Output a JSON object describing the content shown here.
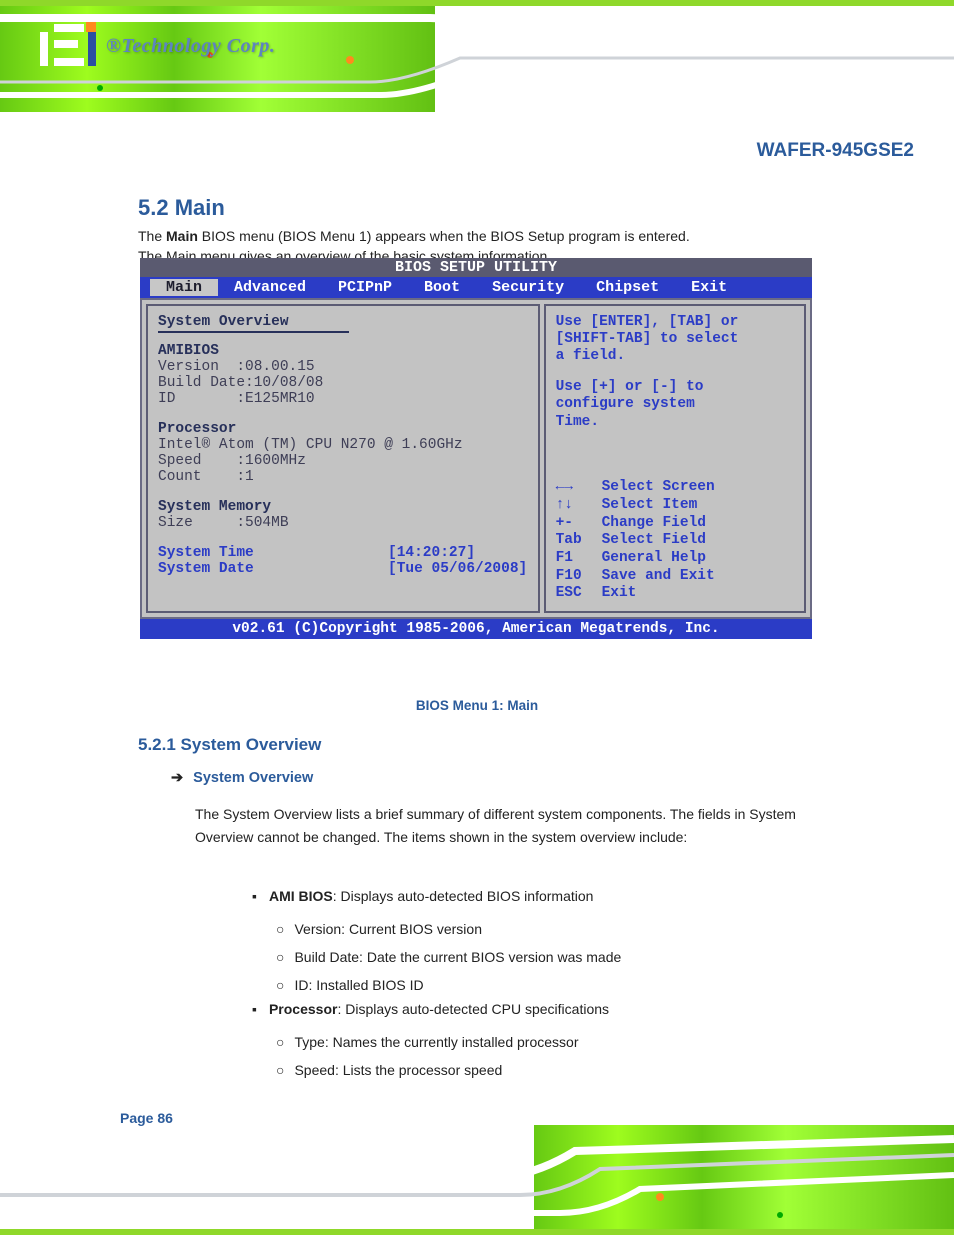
{
  "header": {
    "brand_tagline": "®Technology Corp."
  },
  "doc": {
    "title": "WAFER-945GSE2",
    "heading": "5.2 Main",
    "intro_1": "The ",
    "intro_bold": "Main",
    "intro_2": " BIOS menu (BIOS Menu 1) appears when the BIOS Setup program is entered.",
    "intro_3": "The Main menu gives an overview of the basic system information."
  },
  "bios": {
    "title": "BIOS SETUP UTILITY",
    "tabs": [
      "Main",
      "Advanced",
      "PCIPnP",
      "Boot",
      "Security",
      "Chipset",
      "Exit"
    ],
    "active_tab": 0,
    "left": {
      "overview": "System Overview",
      "amibios": "AMIBIOS",
      "version_label": "Version  :",
      "version": "08.00.15",
      "build_label": "Build Date:",
      "build": "10/08/08",
      "id_label": "ID       :",
      "id": "E125MR10",
      "processor": "Processor",
      "cpu": "Intel® Atom (TM) CPU N270 @ 1.60GHz",
      "speed_label": "Speed    :",
      "speed": "1600MHz",
      "count_label": "Count    :",
      "count": "1",
      "memory": "System Memory",
      "size_label": "Size     :",
      "size": "504MB",
      "time_label": "System Time",
      "time_value": "[14:20:27]",
      "date_label": "System Date",
      "date_value": "[Tue 05/06/2008]"
    },
    "right": {
      "help1": "Use [ENTER], [TAB] or",
      "help2": "[SHIFT-TAB] to select",
      "help3": "a field.",
      "help4": "Use [+] or [-] to",
      "help5": "configure system",
      "help6": "Time.",
      "nav": [
        {
          "key": "←→",
          "desc": "Select Screen"
        },
        {
          "key": "↑↓",
          "desc": "Select Item"
        },
        {
          "key": "+-",
          "desc": "Change Field"
        },
        {
          "key": "Tab",
          "desc": "Select Field"
        },
        {
          "key": "F1",
          "desc": "General Help"
        },
        {
          "key": "F10",
          "desc": "Save and Exit"
        },
        {
          "key": "ESC",
          "desc": "Exit"
        }
      ]
    },
    "footer": "v02.61 (C)Copyright 1985-2006, American Megatrends, Inc."
  },
  "caption": "BIOS Menu 1: Main",
  "subheading": "5.2.1 System Overview",
  "sysoverview_arrow": "System Overview",
  "sysoverview_para": "The System Overview lists a brief summary of different system components. The fields in System Overview cannot be changed. The items shown in the system overview include:",
  "bullet1_bold": "AMI BIOS",
  "bullet1_rest": ": Displays auto-detected BIOS information",
  "b1_sub_version": "Version: Current BIOS version",
  "b1_sub_build": "Build Date: Date the current BIOS version was made",
  "b1_sub_id": "ID: Installed BIOS ID",
  "bullet2_bold": "Processor",
  "bullet2_rest": ": Displays auto-detected CPU specifications",
  "b2_sub_type": "Type: Names the currently installed processor",
  "b2_sub_speed": "Speed: Lists the processor speed",
  "page": "Page 86"
}
